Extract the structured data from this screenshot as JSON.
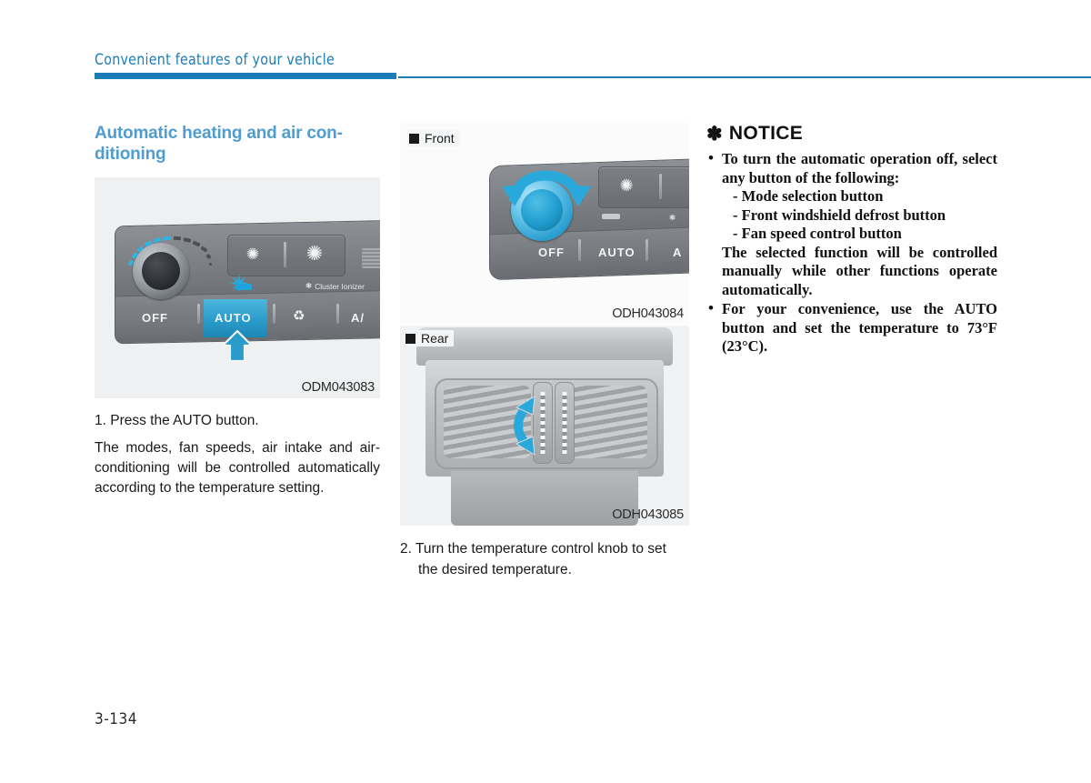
{
  "header": {
    "title": "Convenient features of your vehicle"
  },
  "page_number": "3-134",
  "column_left": {
    "section_title": "Automatic heating and air con-ditioning",
    "figure": {
      "caption": "ODM043083",
      "panel": {
        "off_label": "OFF",
        "auto_label": "AUTO",
        "ac_label": "A/",
        "ionizer_label": "Cluster Ionizer",
        "fan_icon_1": "fan-icon",
        "fan_icon_2": "fan-icon",
        "recirculation_icon": "air-recirculation-icon",
        "ionizer_icon": "ionizer-icon",
        "highlight_arrow_icon": "up-arrow-callout-icon",
        "starburst_icon": "indicator-flash-icon"
      }
    },
    "step_1": "1. Press the AUTO button.",
    "paragraph": "The modes, fan speeds, air intake and air-conditioning will be controlled automatically according to the temperature setting."
  },
  "column_middle": {
    "figure_front": {
      "label": "Front",
      "caption": "ODH043084",
      "off_label": "OFF",
      "auto_label": "AUTO",
      "ac_label": "A",
      "fan_icon": "fan-icon",
      "rotate_arrow_icon": "rotate-knob-arrow-icon"
    },
    "figure_rear": {
      "label": "Rear",
      "caption": "ODH043085",
      "slider_arrow_icon": "slider-arrow-icon"
    },
    "step_2": "2. Turn the temperature control knob to set the desired temperature."
  },
  "column_right": {
    "notice_title": "NOTICE",
    "notice_asterisk": "✽",
    "items": [
      {
        "bullet": "•",
        "lead": "To turn the automatic operation off, select any button of the following:",
        "sub_items": [
          "- Mode selection button",
          "- Front windshield defrost button",
          "- Fan speed control button"
        ],
        "tail": "The selected function will be controlled manually while other functions operate automatically."
      },
      {
        "bullet": "•",
        "lead": "For your convenience, use the AUTO button and set the temperature to 73°F (23°C).",
        "sub_items": [],
        "tail": ""
      }
    ]
  },
  "colors": {
    "header_blue": "#1b7cb8",
    "section_blue": "#4f9dd0",
    "highlight_blue": "#2a9ccb",
    "text_black": "#1a1a1a"
  }
}
